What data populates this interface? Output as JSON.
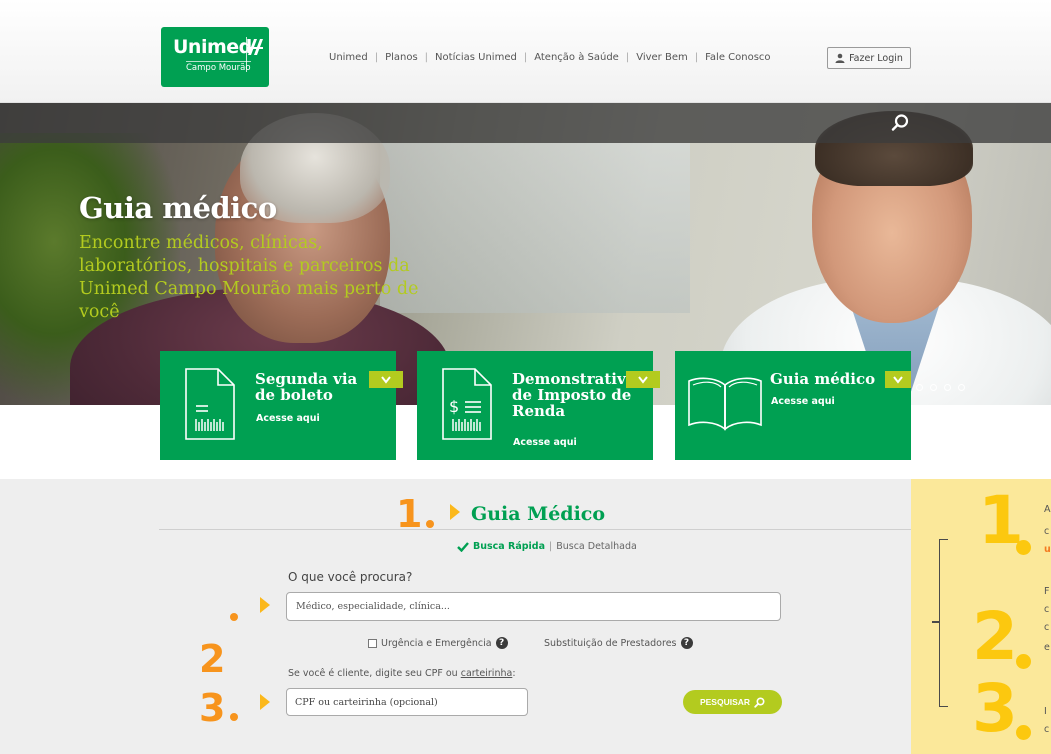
{
  "header": {
    "logo": {
      "brand": "Unimed",
      "sub": "Campo Mourão"
    },
    "nav": [
      "Unimed",
      "Planos",
      "Notícias Unimed",
      "Atenção à Saúde",
      "Viver Bem",
      "Fale Conosco"
    ],
    "login_label": "Fazer Login"
  },
  "hero": {
    "title": "Guia médico",
    "subtitle": "Encontre médicos, clínicas, laboratórios, hospitais e parceiros da Unimed Campo Mourão mais perto de você"
  },
  "cards": [
    {
      "title": "Segunda via\nde boleto",
      "link": "Acesse aqui",
      "icon": "boleto-document-icon"
    },
    {
      "title": "Demonstrativo\nde Imposto de\nRenda",
      "link": "Acesse aqui",
      "icon": "tax-document-icon"
    },
    {
      "title": "Guia médico",
      "link": "Acesse aqui",
      "icon": "open-book-icon"
    }
  ],
  "search": {
    "section_title": "Guia Médico",
    "tab_quick": "Busca Rápida",
    "tab_detailed": "Busca Detalhada",
    "question_label": "O que você procura?",
    "question_placeholder": "Médico, especialidade, clínica...",
    "emergency_label": "Urgência e Emergência",
    "replacement_label": "Substituição de Prestadores",
    "cpf_label_prefix": "Se você é cliente, digite seu CPF ou ",
    "cpf_label_link": "carteirinha",
    "cpf_label_suffix": ":",
    "cpf_placeholder": "CPF ou carteirinha (opcional)",
    "search_button": "PESQUISAR"
  },
  "steps": {
    "one": "1",
    "two": "2",
    "three": "3"
  },
  "help_panel": {
    "lines_1": [
      "A",
      "c",
      "u"
    ],
    "lines_2": [
      "F",
      "c",
      "c",
      "e"
    ],
    "lines_3": [
      "I",
      "c"
    ]
  },
  "colors": {
    "brand_green": "#00a052",
    "lime": "#b3cb1f",
    "orange": "#f7941d",
    "yellow": "#fcc80f",
    "panel_bg": "#fbe89a"
  }
}
